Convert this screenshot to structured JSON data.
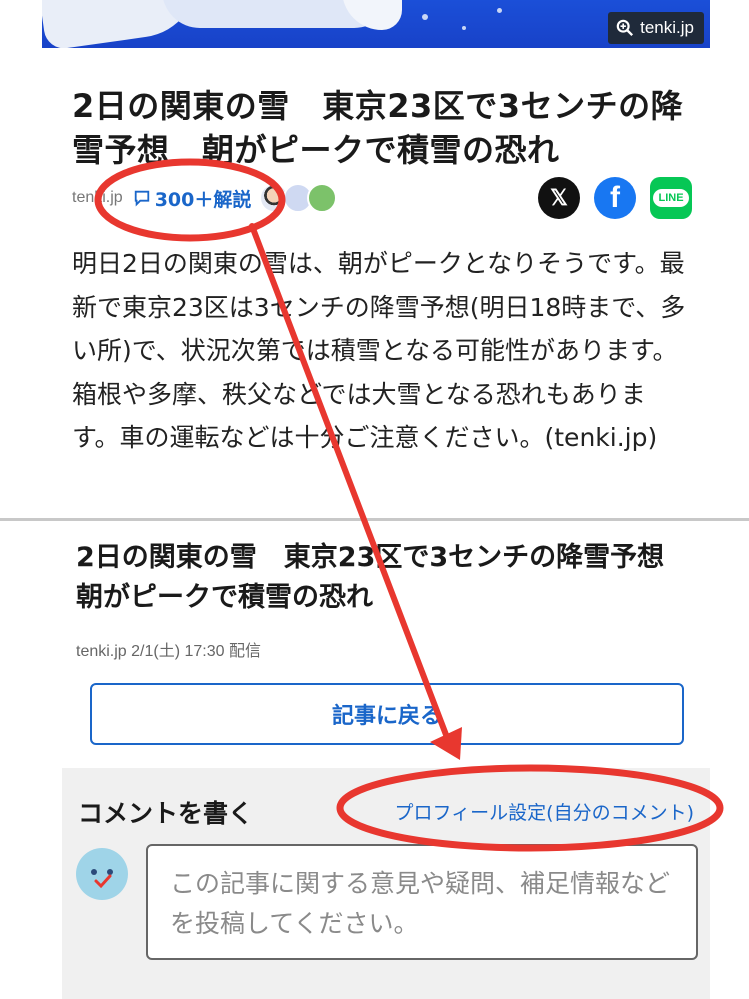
{
  "banner": {
    "credit": "tenki.jp"
  },
  "article": {
    "headline": "2日の関東の雪　東京23区で3センチの降雪予想　朝がピークで積雪の恐れ",
    "source_short": "tenki.jp",
    "comments_label": "300＋解説",
    "share": {
      "x": "𝕏",
      "facebook": "f",
      "line": "LINE"
    },
    "body": "明日2日の関東の雪は、朝がピークとなりそうです。最新で東京23区は3センチの降雪予想(明日18時まで、多い所)で、状況次第では積雪となる可能性があります。箱根や多摩、秩父などでは大雪となる恐れもあります。車の運転などは十分ご注意ください。(tenki.jp)"
  },
  "comments_page": {
    "title": "2日の関東の雪　東京23区で3センチの降雪予想　朝がピークで積雪の恐れ",
    "byline": "tenki.jp 2/1(土) 17:30 配信",
    "back_button": "記事に戻る",
    "write_title": "コメントを書く",
    "profile_link": "プロフィール設定(自分のコメント)",
    "comment_placeholder": "この記事に関する意見や疑問、補足情報などを投稿してください。"
  },
  "colors": {
    "accent": "#1a66c9",
    "annotation": "#e8372f"
  }
}
